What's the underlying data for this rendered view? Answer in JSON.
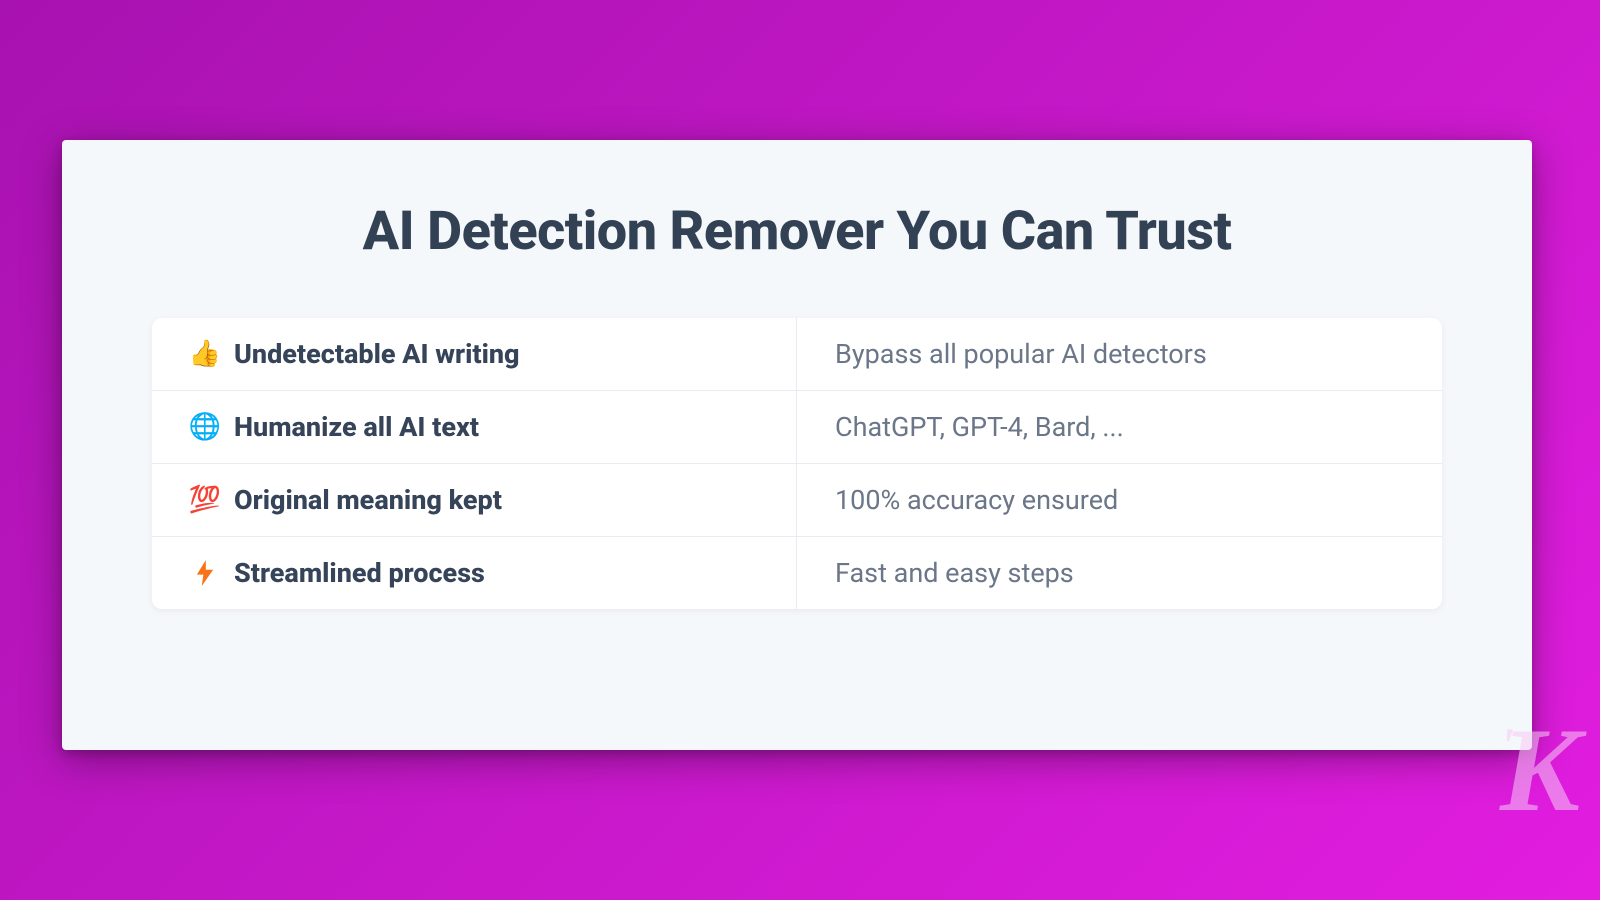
{
  "heading": "AI Detection Remover You Can Trust",
  "features": [
    {
      "icon": "👍",
      "title": "Undetectable AI writing",
      "desc": "Bypass all popular AI detectors"
    },
    {
      "icon": "🌐",
      "title": "Humanize all AI text",
      "desc": "ChatGPT, GPT-4, Bard, ..."
    },
    {
      "icon": "💯",
      "title": "Original meaning kept",
      "desc": "100% accuracy ensured"
    },
    {
      "icon": "⚡",
      "title": "Streamlined process",
      "desc": "Fast and easy steps"
    }
  ],
  "watermark": "K"
}
